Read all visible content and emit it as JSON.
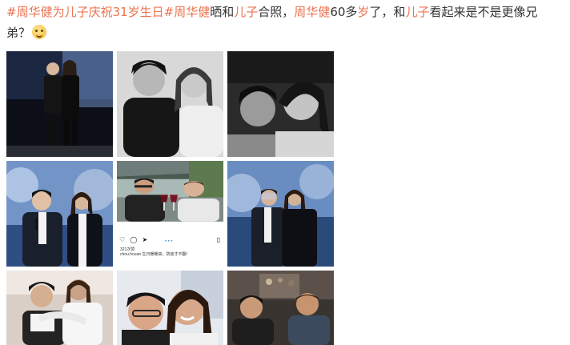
{
  "post": {
    "hashtag1": "#周华健为儿子庆祝31岁生日#",
    "name1": "周华健",
    "text1": "晒和",
    "kw1": "儿子",
    "text2": "合照，",
    "name2": "周华健",
    "text3": "60多",
    "kw2": "岁",
    "text4": "了，和",
    "kw3": "儿子",
    "text5": "看起来是不是更像兄弟？",
    "emoji": "laughing-emoji"
  },
  "colors": {
    "tag": "#eb7350",
    "text": "#333333"
  },
  "photos": [
    {
      "id": "photo-1"
    },
    {
      "id": "photo-2"
    },
    {
      "id": "photo-3"
    },
    {
      "id": "photo-4"
    },
    {
      "id": "photo-5"
    },
    {
      "id": "photo-6"
    },
    {
      "id": "photo-7"
    },
    {
      "id": "photo-8"
    },
    {
      "id": "photo-9"
    }
  ],
  "instagram": {
    "likes": "321次赞",
    "caption": "chou.houan 生日暖暖来，防疫才不翻!"
  }
}
